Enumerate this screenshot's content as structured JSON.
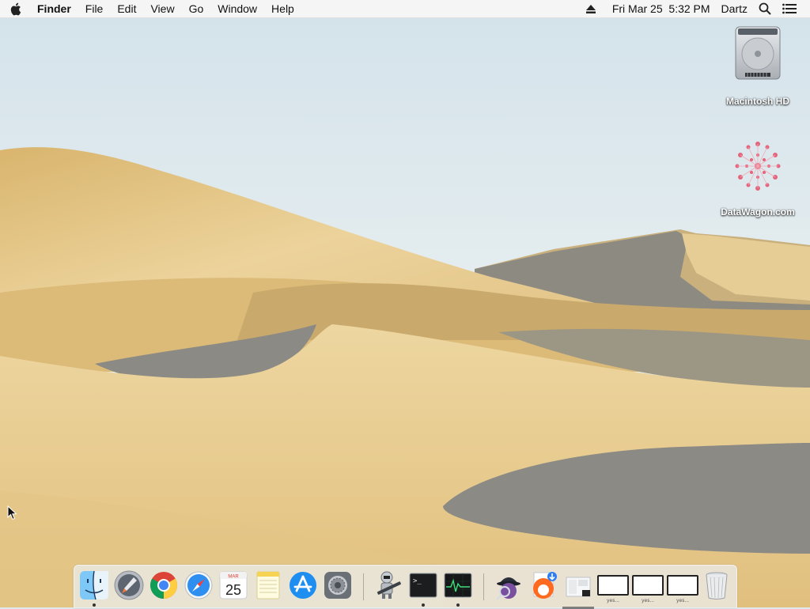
{
  "menubar": {
    "apple_icon": "apple-logo",
    "app_name": "Finder",
    "menus": [
      "File",
      "Edit",
      "View",
      "Go",
      "Window",
      "Help"
    ],
    "status": {
      "eject_icon": "eject-icon",
      "datetime": "Fri Mar 25  5:32 PM",
      "user": "Dartz",
      "search_icon": "spotlight-search-icon",
      "list_icon": "notification-center-icon"
    }
  },
  "desktop": {
    "icons": [
      {
        "label": "Macintosh HD",
        "icon": "hard-drive-icon"
      },
      {
        "label": "DataWagon.com",
        "icon": "datawagon-icon"
      }
    ]
  },
  "dock": {
    "apps": [
      {
        "name": "Finder",
        "icon": "finder-icon",
        "running": true
      },
      {
        "name": "Launchpad",
        "icon": "launchpad-icon",
        "running": false
      },
      {
        "name": "Google Chrome",
        "icon": "chrome-icon",
        "running": false
      },
      {
        "name": "Safari",
        "icon": "safari-icon",
        "running": false
      },
      {
        "name": "Calendar",
        "icon": "calendar-icon",
        "running": false,
        "month": "MAR",
        "day": "25"
      },
      {
        "name": "Notes",
        "icon": "notes-icon",
        "running": false
      },
      {
        "name": "App Store",
        "icon": "app-store-icon",
        "running": false
      },
      {
        "name": "System Preferences",
        "icon": "system-preferences-icon",
        "running": false
      },
      {
        "name": "Automator",
        "icon": "automator-icon",
        "running": false
      },
      {
        "name": "Terminal",
        "icon": "terminal-icon",
        "running": true,
        "prompt": ">_"
      },
      {
        "name": "Activity Monitor",
        "icon": "activity-monitor-icon",
        "running": true
      },
      {
        "name": "Alfred",
        "icon": "alfred-icon",
        "running": false
      },
      {
        "name": "Downloads",
        "icon": "downloads-stack-icon",
        "running": false
      },
      {
        "name": "Document Stack",
        "icon": "document-stack-icon",
        "running": false
      }
    ],
    "minimized": [
      {
        "caption": "yes..."
      },
      {
        "caption": "yes..."
      },
      {
        "caption": "yes..."
      }
    ],
    "trash": {
      "name": "Trash",
      "icon": "trash-icon"
    }
  },
  "colors": {
    "sky_top": "#dde8ec",
    "sand": "#e3c585",
    "shadow": "#8a8c8c"
  }
}
